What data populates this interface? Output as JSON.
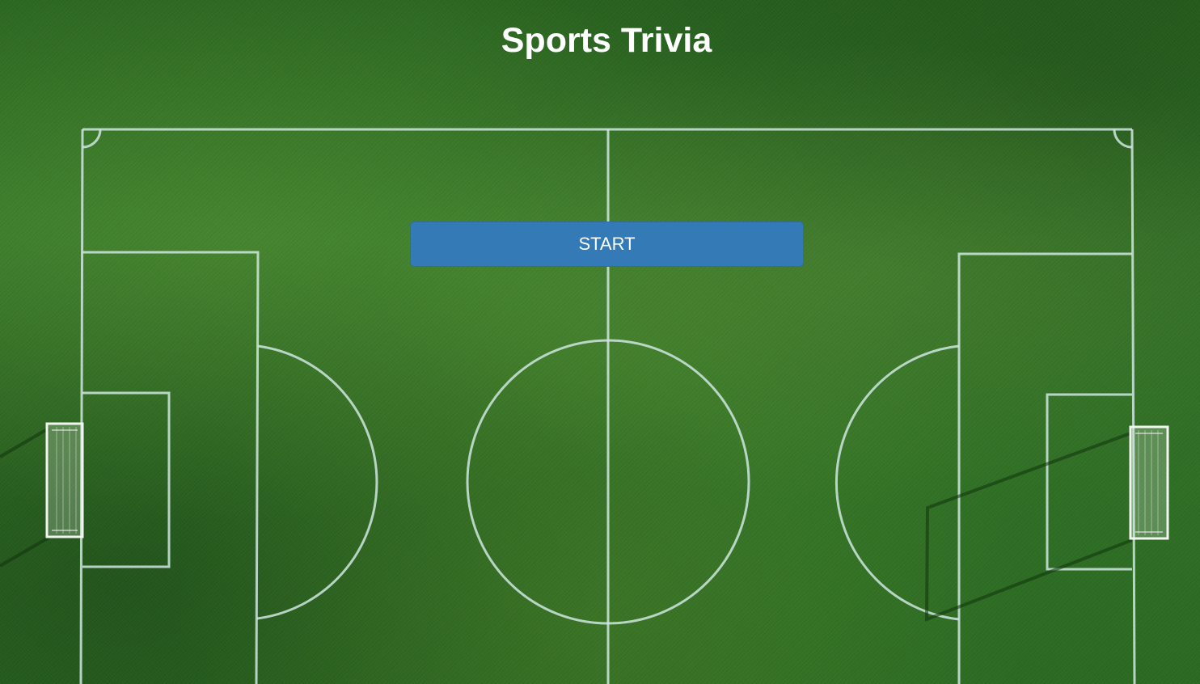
{
  "page": {
    "title": "Sports Trivia",
    "start_button_label": "START"
  },
  "background": {
    "depicts": "soccer-pitch",
    "grass_color": "#2f7025",
    "line_color": "#cfe6e0"
  },
  "colors": {
    "button_background": "#337ab7",
    "title_text": "#ffffff"
  }
}
